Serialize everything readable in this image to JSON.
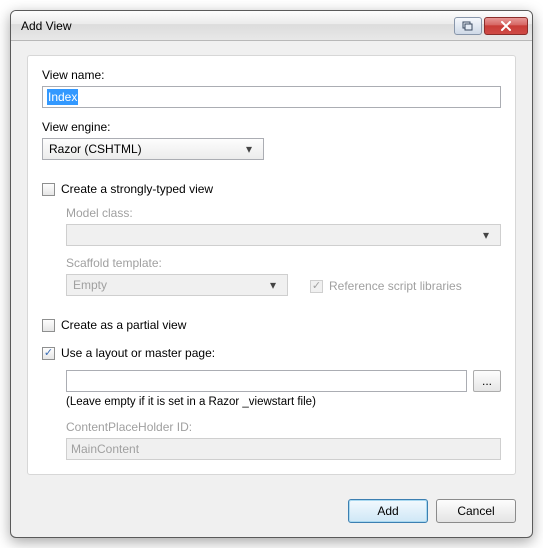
{
  "window": {
    "title": "Add View"
  },
  "form": {
    "viewName": {
      "label": "View name:",
      "value": "Index"
    },
    "viewEngine": {
      "label": "View engine:",
      "value": "Razor (CSHTML)"
    },
    "stronglyTyped": {
      "checked": false,
      "label": "Create a strongly-typed view",
      "modelClass": {
        "label": "Model class:",
        "value": ""
      },
      "scaffold": {
        "label": "Scaffold template:",
        "value": "Empty"
      },
      "referenceScripts": {
        "checked": true,
        "label": "Reference script libraries"
      }
    },
    "partialView": {
      "checked": false,
      "label": "Create as a partial view"
    },
    "layout": {
      "checked": true,
      "label": "Use a layout or master page:",
      "path": "",
      "browse": "...",
      "hint": "(Leave empty if it is set in a Razor _viewstart file)",
      "contentPlaceholder": {
        "label": "ContentPlaceHolder ID:",
        "value": "MainContent"
      }
    }
  },
  "buttons": {
    "add": "Add",
    "cancel": "Cancel"
  }
}
